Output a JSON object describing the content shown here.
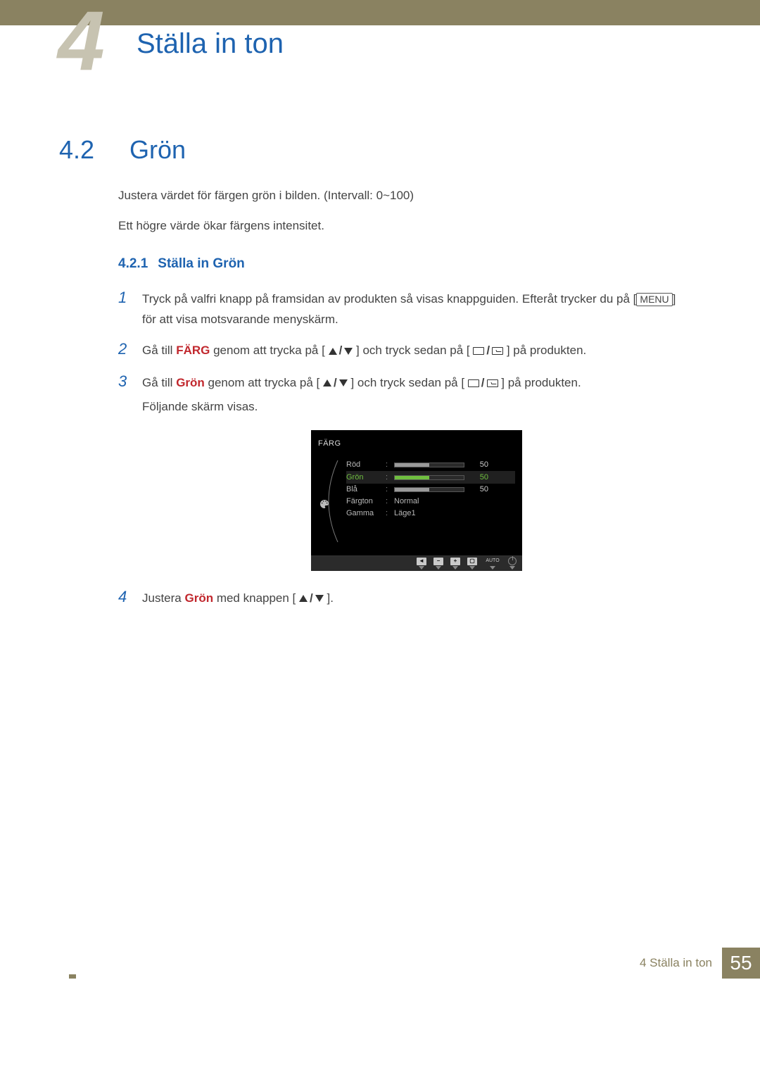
{
  "chapter": {
    "number": "4",
    "title": "Ställa in ton"
  },
  "section": {
    "number": "4.2",
    "title": "Grön",
    "desc_line1": "Justera värdet för färgen grön i bilden. (Intervall: 0~100)",
    "desc_line2": "Ett högre värde ökar färgens intensitet."
  },
  "subsection": {
    "number": "4.2.1",
    "title": "Ställa in Grön"
  },
  "steps": {
    "s1_num": "1",
    "s1_a": "Tryck på valfri knapp på framsidan av produkten så visas knappguiden. Efteråt trycker du på [",
    "s1_menu": "MENU",
    "s1_b": "] för att visa motsvarande menyskärm.",
    "s2_num": "2",
    "s2_a": "Gå till ",
    "s2_kw": "FÄRG",
    "s2_b": " genom att trycka på [",
    "s2_c": "] och tryck sedan på [",
    "s2_d": "] på produkten.",
    "s3_num": "3",
    "s3_a": "Gå till ",
    "s3_kw": "Grön",
    "s3_b": " genom att trycka på [",
    "s3_c": "] och tryck sedan på [",
    "s3_d": "] på produkten.",
    "s3_follow": "Följande skärm visas.",
    "s4_num": "4",
    "s4_a": "Justera ",
    "s4_kw": "Grön",
    "s4_b": " med knappen [",
    "s4_c": "]."
  },
  "osd": {
    "title": "FÄRG",
    "items": {
      "rod": {
        "label": "Röd",
        "value": "50"
      },
      "gron": {
        "label": "Grön",
        "value": "50"
      },
      "bla": {
        "label": "Blå",
        "value": "50"
      },
      "fargton": {
        "label": "Färgton",
        "value": "Normal"
      },
      "gamma": {
        "label": "Gamma",
        "value": "Läge1"
      }
    },
    "bottom": {
      "btn1": "◄",
      "btn2": "−",
      "btn3": "+",
      "btn4": "▢",
      "auto": "AUTO"
    }
  },
  "footer": {
    "text": "4 Ställa in ton",
    "page": "55"
  }
}
